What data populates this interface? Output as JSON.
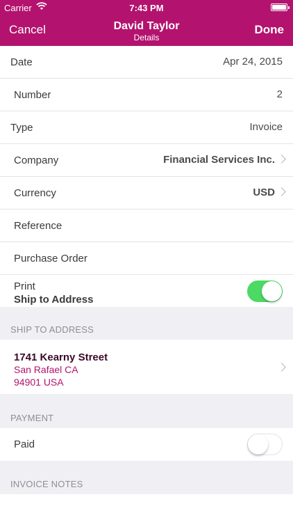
{
  "status_bar": {
    "carrier": "Carrier",
    "time": "7:43 PM"
  },
  "nav": {
    "cancel_label": "Cancel",
    "title": "David Taylor",
    "subtitle": "Details",
    "done_label": "Done"
  },
  "details": {
    "date": {
      "label": "Date",
      "value": "Apr 24, 2015"
    },
    "number": {
      "label": "Number",
      "value": "2"
    },
    "type": {
      "label": "Type",
      "value": "Invoice"
    },
    "company": {
      "label": "Company",
      "value": "Financial Services Inc."
    },
    "currency": {
      "label": "Currency",
      "value": "USD"
    },
    "reference": {
      "label": "Reference",
      "value": ""
    },
    "purchase_order": {
      "label": "Purchase Order",
      "value": ""
    },
    "print_ship": {
      "label_line1": "Print",
      "label_line2": "Ship to Address",
      "enabled": true
    }
  },
  "ship_to": {
    "header": "SHIP TO ADDRESS",
    "street": "1741 Kearny Street",
    "city_state": "San Rafael CA",
    "zip_country": "94901 USA"
  },
  "payment": {
    "header": "PAYMENT",
    "paid_label": "Paid",
    "paid": false
  },
  "notes": {
    "header": "INVOICE NOTES"
  },
  "colors": {
    "accent": "#b3136e",
    "toggle_on": "#4cd964",
    "background": "#f0eff4"
  }
}
